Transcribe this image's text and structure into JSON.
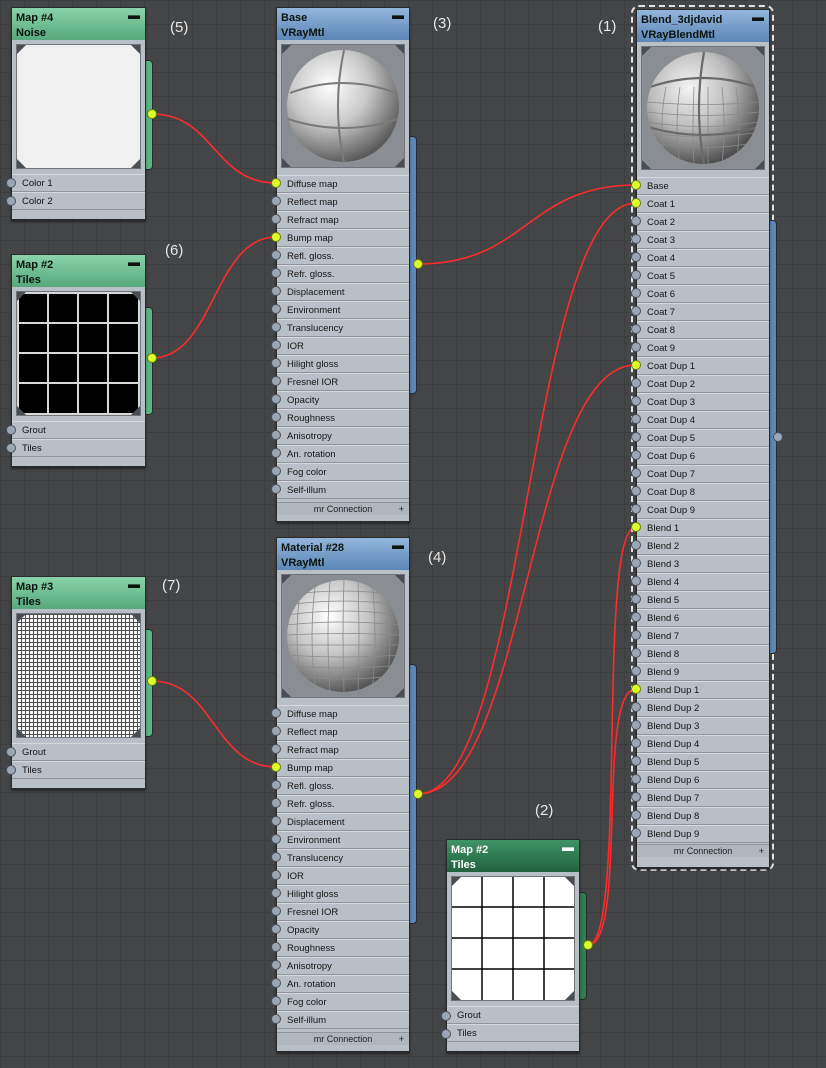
{
  "colors": {
    "wire": "#ff2a2a",
    "socket_active": "#dcff2a",
    "socket_idle": "#9ba6b4",
    "node_green": "#5ab483",
    "node_blue": "#5d87b7",
    "node_dark_green": "#2f7d51",
    "background": "#444547"
  },
  "labels": {
    "n1": "(1)",
    "n2": "(2)",
    "n3": "(3)",
    "n4": "(4)",
    "n5": "(5)",
    "n6": "(6)",
    "n7": "(7)"
  },
  "nodes": {
    "noise": {
      "name": "Map #4",
      "type": "Noise",
      "slots": [
        "Color 1",
        "Color 2"
      ]
    },
    "tiles_top": {
      "name": "Map #2",
      "type": "Tiles",
      "slots": [
        "Grout",
        "Tiles"
      ]
    },
    "tiles_mid": {
      "name": "Map #3",
      "type": "Tiles",
      "slots": [
        "Grout",
        "Tiles"
      ]
    },
    "tiles_bottom": {
      "name": "Map #2",
      "type": "Tiles",
      "slots": [
        "Grout",
        "Tiles"
      ]
    },
    "base": {
      "name": "Base",
      "type": "VRayMtl",
      "slots": [
        "Diffuse map",
        "Reflect map",
        "Refract map",
        "Bump map",
        "Refl. gloss.",
        "Refr. gloss.",
        "Displacement",
        "Environment",
        "Translucency",
        "IOR",
        "Hilight gloss",
        "Fresnel IOR",
        "Opacity",
        "Roughness",
        "Anisotropy",
        "An. rotation",
        "Fog color",
        "Self-illum"
      ],
      "footer": "mr Connection"
    },
    "material28": {
      "name": "Material #28",
      "type": "VRayMtl",
      "slots": [
        "Diffuse map",
        "Reflect map",
        "Refract map",
        "Bump map",
        "Refl. gloss.",
        "Refr. gloss.",
        "Displacement",
        "Environment",
        "Translucency",
        "IOR",
        "Hilight gloss",
        "Fresnel IOR",
        "Opacity",
        "Roughness",
        "Anisotropy",
        "An. rotation",
        "Fog color",
        "Self-illum"
      ],
      "footer": "mr Connection"
    },
    "blend": {
      "name": "Blend_3djdavid",
      "type": "VRayBlendMtl",
      "slots": [
        "Base",
        "Coat 1",
        "Coat 2",
        "Coat 3",
        "Coat 4",
        "Coat 5",
        "Coat 6",
        "Coat 7",
        "Coat 8",
        "Coat 9",
        "Coat Dup 1",
        "Coat Dup 2",
        "Coat Dup 3",
        "Coat Dup 4",
        "Coat Dup 5",
        "Coat Dup 6",
        "Coat Dup 7",
        "Coat Dup 8",
        "Coat Dup 9",
        "Blend 1",
        "Blend 2",
        "Blend 3",
        "Blend 4",
        "Blend 5",
        "Blend 6",
        "Blend 7",
        "Blend 8",
        "Blend 9",
        "Blend Dup 1",
        "Blend Dup 2",
        "Blend Dup 3",
        "Blend Dup 4",
        "Blend Dup 5",
        "Blend Dup 6",
        "Blend Dup 7",
        "Blend Dup 8",
        "Blend Dup 9"
      ],
      "footer": "mr Connection"
    }
  },
  "connections": [
    {
      "from": "noise",
      "to": "base",
      "slot": "Diffuse map"
    },
    {
      "from": "tiles_top",
      "to": "base",
      "slot": "Bump map"
    },
    {
      "from": "tiles_mid",
      "to": "material28",
      "slot": "Bump map"
    },
    {
      "from": "base",
      "to": "blend",
      "slot": "Base"
    },
    {
      "from": "material28",
      "to": "blend",
      "slot": "Coat 1"
    },
    {
      "from": "material28",
      "to": "blend",
      "slot": "Coat Dup 1"
    },
    {
      "from": "tiles_bottom",
      "to": "blend",
      "slot": "Blend 1"
    },
    {
      "from": "tiles_bottom",
      "to": "blend",
      "slot": "Blend Dup 1"
    }
  ]
}
